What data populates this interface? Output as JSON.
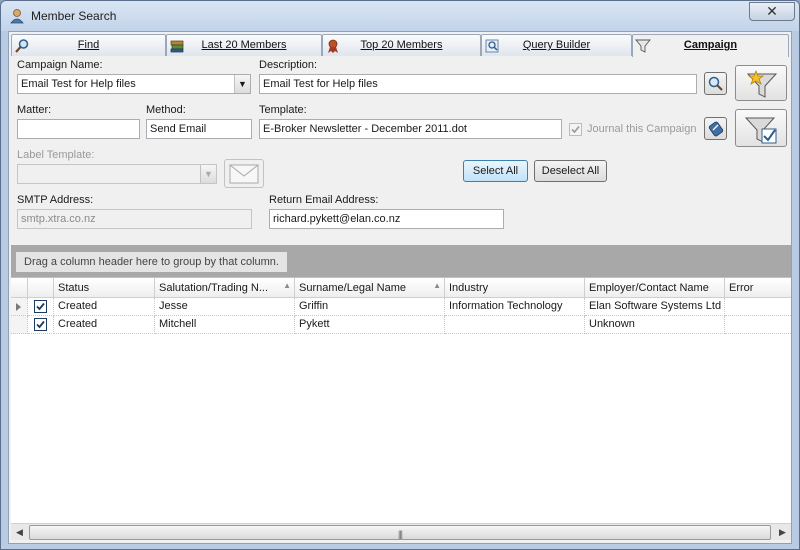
{
  "window": {
    "title": "Member Search",
    "close_glyph": "✕"
  },
  "tabs": [
    {
      "label": "Find",
      "icon": "magnifier-icon",
      "active": false
    },
    {
      "label": "Last 20 Members",
      "icon": "books-icon",
      "active": false
    },
    {
      "label": "Top 20 Members",
      "icon": "award-ribbon-icon",
      "active": false
    },
    {
      "label": "Query Builder",
      "icon": "query-icon",
      "active": false
    },
    {
      "label": "Campaign",
      "icon": "funnel-icon",
      "active": true
    }
  ],
  "form": {
    "campaign_name_label": "Campaign Name:",
    "campaign_name_value": "Email Test for Help files",
    "description_label": "Description:",
    "description_value": "Email Test for Help files",
    "matter_label": "Matter:",
    "matter_value": "",
    "method_label": "Method:",
    "method_value": "Send Email",
    "template_label": "Template:",
    "template_value": "E-Broker Newsletter - December 2011.dot",
    "journal_label": "Journal this Campaign",
    "journal_checked": true,
    "label_template_label": "Label Template:",
    "label_template_value": "",
    "smtp_label": "SMTP Address:",
    "smtp_value": "smtp.xtra.co.nz",
    "return_email_label": "Return Email Address:",
    "return_email_value": "richard.pykett@elan.co.nz",
    "select_all_label": "Select All",
    "deselect_all_label": "Deselect All"
  },
  "grid": {
    "group_hint": "Drag a column header here to group by that column.",
    "columns": [
      "Status",
      "Salutation/Trading N...",
      "Surname/Legal Name",
      "Industry",
      "Employer/Contact Name",
      "Error"
    ],
    "rows": [
      {
        "checked": true,
        "current": true,
        "cells": [
          "Created",
          "Jesse",
          "Griffin",
          "Information Technology",
          "Elan Software Systems Ltd",
          ""
        ]
      },
      {
        "checked": true,
        "current": false,
        "cells": [
          "Created",
          "Mitchell",
          "Pykett",
          "",
          "Unknown",
          ""
        ]
      }
    ]
  },
  "scrollbar": {
    "left_arrow": "◀",
    "right_arrow": "▶",
    "grip": "|||"
  },
  "colors": {
    "accent": "#3c7fb1",
    "group_panel": "#a8a8a8",
    "window_frame": "#c2d4ea"
  }
}
